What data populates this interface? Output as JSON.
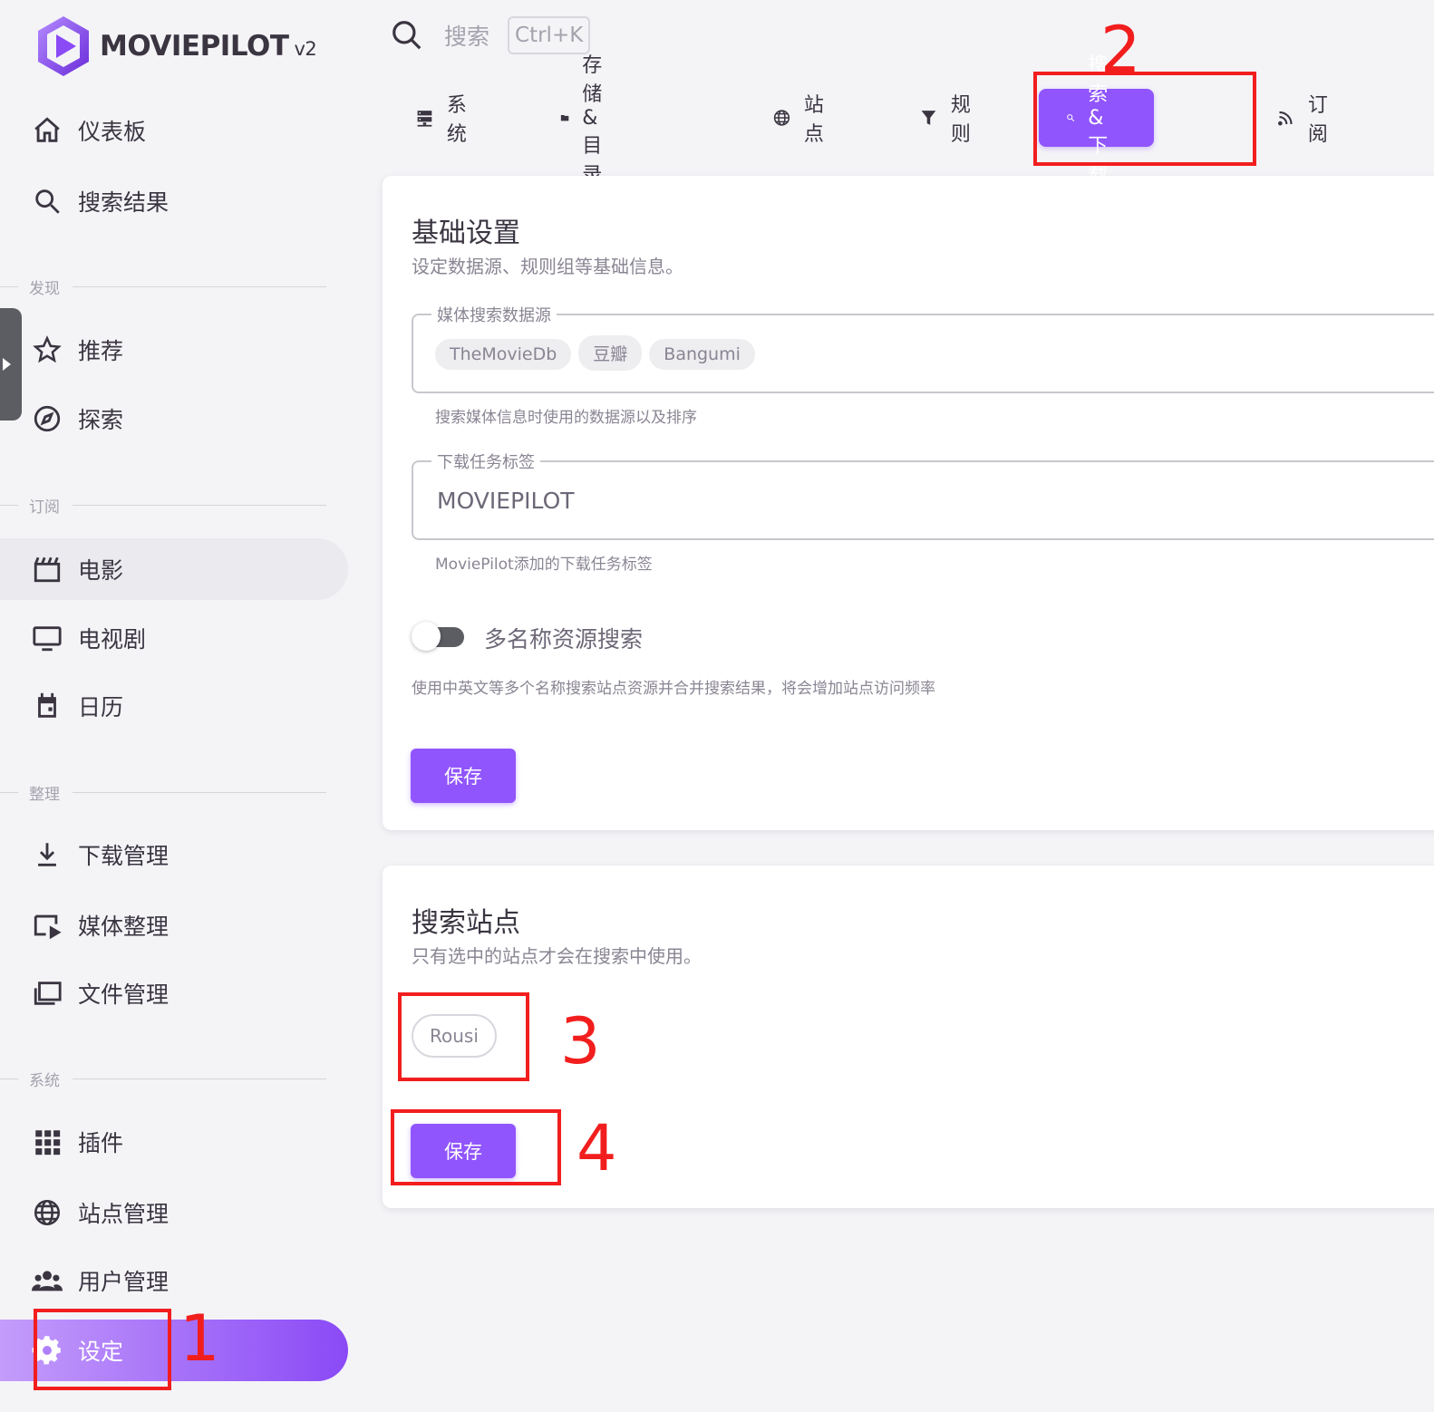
{
  "app": {
    "logo_text": "MOVIEPILOT",
    "logo_version": "v2"
  },
  "search": {
    "label": "搜索",
    "shortcut": "Ctrl+K"
  },
  "sidebar": {
    "top_items": [
      {
        "label": "仪表板",
        "icon": "home-icon"
      },
      {
        "label": "搜索结果",
        "icon": "search-icon"
      }
    ],
    "sections": {
      "discover": "发现",
      "subscribe": "订阅",
      "organize": "整理",
      "system": "系统"
    },
    "discover_items": [
      {
        "label": "推荐",
        "icon": "star-icon"
      },
      {
        "label": "探索",
        "icon": "compass-icon"
      }
    ],
    "subscribe_items": [
      {
        "label": "电影",
        "icon": "movie-clapper-icon"
      },
      {
        "label": "电视剧",
        "icon": "tv-icon"
      },
      {
        "label": "日历",
        "icon": "calendar-icon"
      }
    ],
    "organize_items": [
      {
        "label": "下载管理",
        "icon": "download-icon"
      },
      {
        "label": "媒体整理",
        "icon": "folder-play-icon"
      },
      {
        "label": "文件管理",
        "icon": "files-icon"
      }
    ],
    "system_items": [
      {
        "label": "插件",
        "icon": "apps-grid-icon"
      },
      {
        "label": "站点管理",
        "icon": "globe-icon"
      },
      {
        "label": "用户管理",
        "icon": "users-icon"
      },
      {
        "label": "设定",
        "icon": "gear-icon"
      }
    ]
  },
  "tabs": [
    {
      "label": "系统",
      "icon": "server-icon"
    },
    {
      "label": "存储 & 目录",
      "icon": "folder-icon"
    },
    {
      "label": "站点",
      "icon": "globe-icon"
    },
    {
      "label": "规则",
      "icon": "filter-icon"
    },
    {
      "label": "搜索 & 下载",
      "icon": "search-icon"
    },
    {
      "label": "订阅",
      "icon": "rss-icon"
    }
  ],
  "basic_settings": {
    "title": "基础设置",
    "subtitle": "设定数据源、规则组等基础信息。",
    "media_source": {
      "legend": "媒体搜索数据源",
      "chips": [
        "TheMovieDb",
        "豆瓣",
        "Bangumi"
      ],
      "hint": "搜索媒体信息时使用的数据源以及排序"
    },
    "download_tag": {
      "legend": "下载任务标签",
      "value": "MOVIEPILOT",
      "hint": "MoviePilot添加的下载任务标签"
    },
    "multi_name": {
      "label": "多名称资源搜索",
      "enabled": false,
      "hint": "使用中英文等多个名称搜索站点资源并合并搜索结果，将会增加站点访问频率"
    },
    "save_label": "保存"
  },
  "search_sites": {
    "title": "搜索站点",
    "subtitle": "只有选中的站点才会在搜索中使用。",
    "sites": [
      "Rousi"
    ],
    "save_label": "保存"
  },
  "annotations": {
    "one": "1",
    "two": "2",
    "three": "3",
    "four": "4",
    "color": "#f21e1e"
  },
  "colors": {
    "accent": "#9055fd",
    "background": "#f4f4f7",
    "text": "#3a3541"
  }
}
